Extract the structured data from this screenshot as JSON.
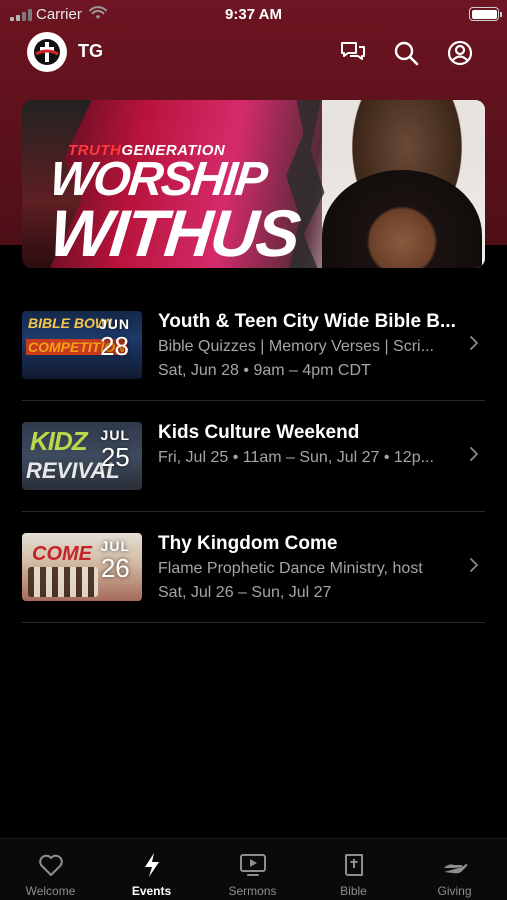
{
  "status_bar": {
    "carrier": "Carrier",
    "time": "9:37 AM"
  },
  "top_bar": {
    "app_title": "TG",
    "icons": [
      "chat-icon",
      "search-icon",
      "profile-icon"
    ]
  },
  "banner": {
    "brand_prefix": "TRUTH",
    "brand_suffix": "GENERATION",
    "headline_line1": "WORSHIP",
    "headline_line2": "WITHUS"
  },
  "events": [
    {
      "title": "Youth & Teen City Wide Bible B...",
      "subtitle": "Bible Quizzes | Memory Verses | Scri...",
      "time": "Sat, Jun 28 • 9am – 4pm CDT",
      "month": "JUN",
      "day": "28",
      "thumb_text_1": "BIBLE BOWL",
      "thumb_text_2": "COMPETITION"
    },
    {
      "title": "Kids Culture Weekend",
      "subtitle": "Fri, Jul 25 • 11am – Sun, Jul 27 • 12p...",
      "time": "",
      "month": "JUL",
      "day": "25",
      "thumb_text_1": "KIDZ",
      "thumb_text_2": "REVIVAL"
    },
    {
      "title": "Thy Kingdom Come",
      "subtitle": "Flame Prophetic Dance Ministry, host",
      "time": "Sat, Jul 26 – Sun, Jul 27",
      "month": "JUL",
      "day": "26",
      "thumb_text_1": "COME",
      "thumb_text_2": ""
    }
  ],
  "tabs": [
    {
      "label": "Welcome",
      "icon": "heart-icon",
      "active": false
    },
    {
      "label": "Events",
      "icon": "lightning-icon",
      "active": true
    },
    {
      "label": "Sermons",
      "icon": "tv-play-icon",
      "active": false
    },
    {
      "label": "Bible",
      "icon": "bible-icon",
      "active": false
    },
    {
      "label": "Giving",
      "icon": "giving-hand-icon",
      "active": false
    }
  ],
  "colors": {
    "header_bg": "#5b111b",
    "page_bg": "#000000",
    "secondary_text": "#a5a5a5",
    "tab_inactive": "#8e8e8e",
    "tab_active": "#ffffff"
  }
}
